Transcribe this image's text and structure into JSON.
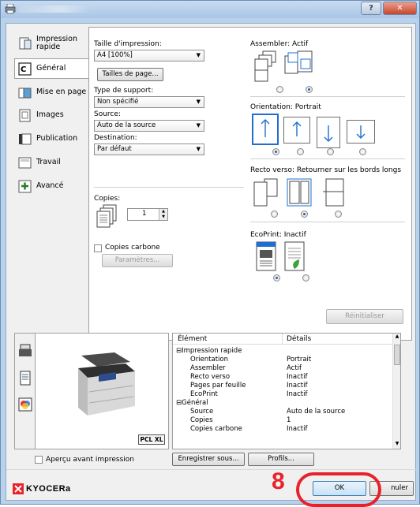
{
  "nav": {
    "items": [
      {
        "label": "Impression rapide",
        "icon": "quick-print-icon"
      },
      {
        "label": "Général",
        "icon": "general-icon"
      },
      {
        "label": "Mise en page",
        "icon": "layout-icon"
      },
      {
        "label": "Images",
        "icon": "images-icon"
      },
      {
        "label": "Publication",
        "icon": "publishing-icon"
      },
      {
        "label": "Travail",
        "icon": "job-icon"
      },
      {
        "label": "Avancé",
        "icon": "advanced-icon"
      }
    ]
  },
  "general": {
    "print_size_label": "Taille d'impression:",
    "print_size_value": "A4 [100%]",
    "page_sizes_button": "Tailles de page...",
    "media_type_label": "Type de support:",
    "media_type_value": "Non spécifié",
    "source_label": "Source:",
    "source_value": "Auto de la source",
    "destination_label": "Destination:",
    "destination_value": "Par défaut",
    "copies_label": "Copies:",
    "copies_value": "1",
    "carbon_copies_label": "Copies carbone",
    "parameters_button": "Paramètres...",
    "collate_label": "Assembler: Actif",
    "orientation_label": "Orientation: Portrait",
    "duplex_label": "Recto verso: Retourner sur les bords longs",
    "ecoprint_label": "EcoPrint: Inactif",
    "reset_button": "Réinitialiser"
  },
  "summary": {
    "col_item": "Élément",
    "col_details": "Détails",
    "rows": [
      {
        "item": "⊟Impression rapide",
        "detail": "",
        "indent": 0
      },
      {
        "item": "Orientation",
        "detail": "Portrait",
        "indent": 1
      },
      {
        "item": "Assembler",
        "detail": "Actif",
        "indent": 1
      },
      {
        "item": "Recto verso",
        "detail": "Inactif",
        "indent": 1
      },
      {
        "item": "Pages par feuille",
        "detail": "Inactif",
        "indent": 1
      },
      {
        "item": "EcoPrint",
        "detail": "Inactif",
        "indent": 1
      },
      {
        "item": "⊟Général",
        "detail": "",
        "indent": 0
      },
      {
        "item": "Source",
        "detail": "Auto de la source",
        "indent": 1
      },
      {
        "item": "Copies",
        "detail": "1",
        "indent": 1
      },
      {
        "item": "Copies carbone",
        "detail": "Inactif",
        "indent": 1
      }
    ]
  },
  "preview": {
    "pdl_badge": "PCL XL"
  },
  "footer": {
    "preview_checkbox_label": "Aperçu avant impression",
    "save_as_button": "Enregistrer sous...",
    "profiles_button": "Profils...",
    "brand": "KYOCERa",
    "ok_button": "OK",
    "cancel_button": "nuler",
    "step_number": "8"
  },
  "colors": {
    "accent_red": "#e8222a",
    "selection_blue": "#1f6fd0"
  }
}
